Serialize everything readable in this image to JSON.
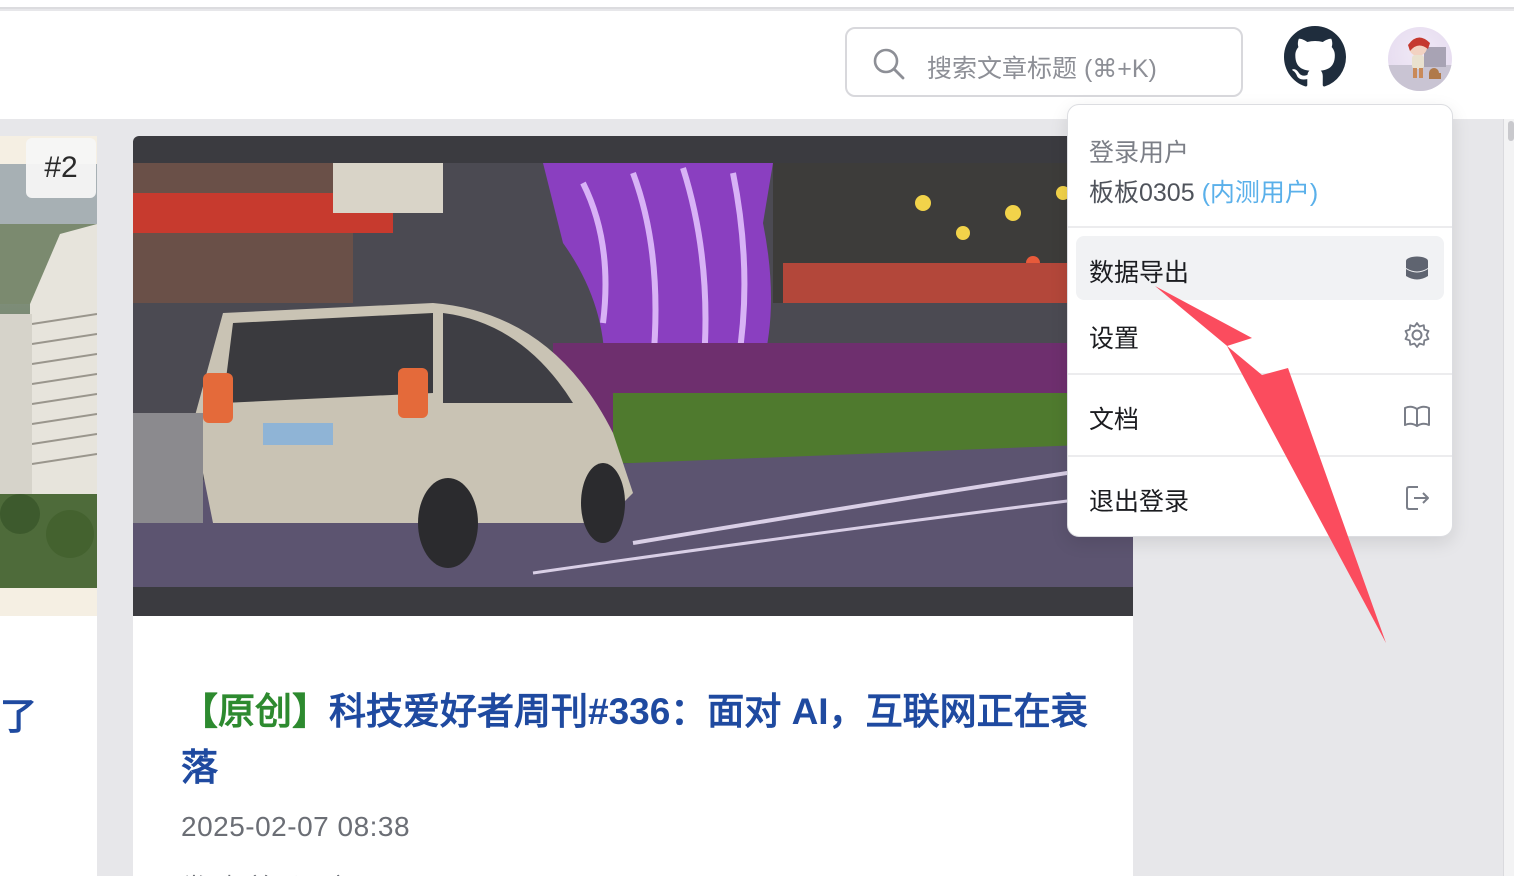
{
  "header": {
    "search_placeholder": "搜索文章标题 (⌘+K)"
  },
  "left_card": {
    "rank": "#2",
    "title_fragment": "了"
  },
  "article": {
    "tag": "【原创】",
    "title": "科技爱好者周刊#336：面对 AI，互联网正在衰落",
    "date": "2025-02-07 08:38",
    "meta": "类型: 普通用户"
  },
  "user_menu": {
    "login_label": "登录用户",
    "username": "板板0305",
    "role": "(内测用户)",
    "items": [
      {
        "label": "数据导出",
        "icon": "database-icon"
      },
      {
        "label": "设置",
        "icon": "gear-icon"
      },
      {
        "label": "文档",
        "icon": "book-icon"
      },
      {
        "label": "退出登录",
        "icon": "logout-icon"
      }
    ]
  },
  "annotation": {
    "color": "#fb4c5e",
    "points_to": "数据导出"
  }
}
